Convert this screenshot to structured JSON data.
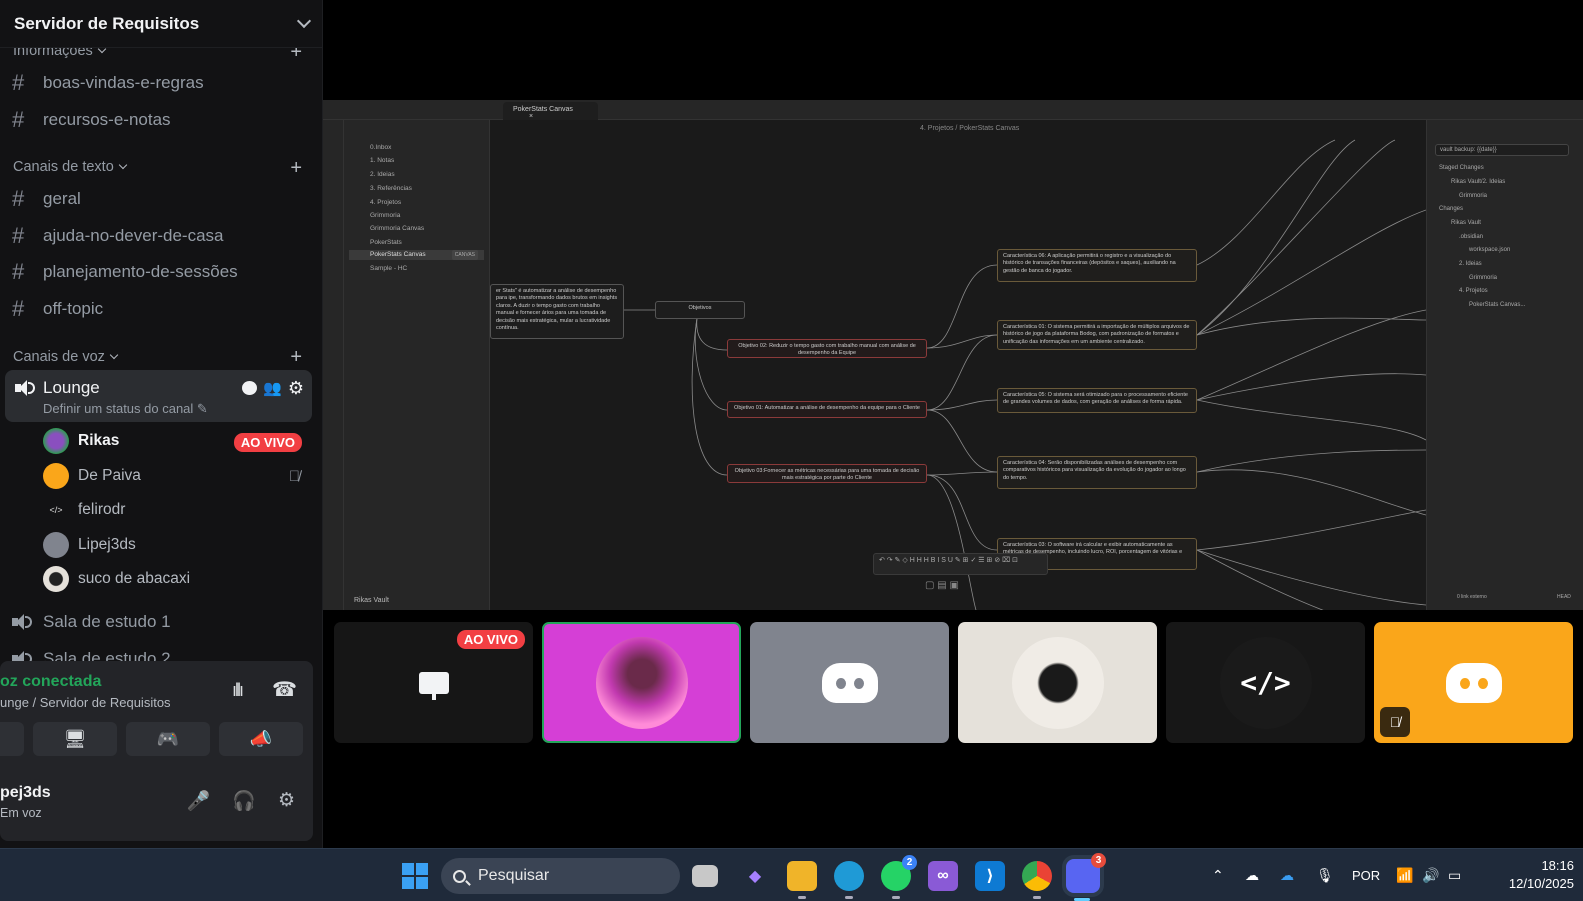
{
  "server": {
    "name": "Servidor de Requisitos"
  },
  "categories": {
    "info": "Informações",
    "text": "Canais de texto",
    "voice": "Canais de voz"
  },
  "info_channels": [
    "boas-vindas-e-regras",
    "recursos-e-notas"
  ],
  "text_channels": [
    "geral",
    "ajuda-no-dever-de-casa",
    "planejamento-de-sessões",
    "off-topic"
  ],
  "voice_channels": {
    "active": {
      "name": "Lounge",
      "status_placeholder": "Definir um status do canal"
    },
    "others": [
      "Sala de estudo 1",
      "Sala de estudo 2"
    ]
  },
  "voice_users": [
    {
      "name": "Rikas",
      "live": "AO VIVO"
    },
    {
      "name": "De Paiva"
    },
    {
      "name": "felirodr"
    },
    {
      "name": "Lipej3ds"
    },
    {
      "name": "suco de abacaxi"
    }
  ],
  "voice_panel": {
    "connected": "oz conectada",
    "location": "unge / Servidor de Requisitos",
    "username": "pej3ds",
    "user_status": "Em voz"
  },
  "stream": {
    "tab_title": "PokerStats Canvas",
    "breadcrumb": "4. Projetos / PokerStats Canvas",
    "vault_name": "Rikas Vault",
    "file_tree": [
      "0.Inbox",
      "1. Notas",
      "2. Ideias",
      "3. Referências",
      "4. Projetos",
      "Grimmoria",
      "Grimmoria Canvas",
      "PokerStats",
      "PokerStats Canvas",
      "Sample - HC"
    ],
    "file_tag": "CANVAS",
    "git_commit_placeholder": "vault backup: {{date}}",
    "git_tree": [
      "Staged Changes",
      "Rikas Vault/2. Ideias",
      "Grimmoria",
      "Changes",
      "Rikas Vault",
      ".obsidian",
      "workspace.json",
      "2. Ideias",
      "Grimmoria",
      "4. Projetos",
      "PokerStats Canvas..."
    ],
    "status_bar": "0 link externo",
    "status_bar_right": "HEAD",
    "nodes": {
      "intro": "er Stats\" é automatizar a análise de desempenho para ipe, transformando dados brutos em insights claros. A duzir o tempo gasto com trabalho manual e fornecer ários para uma tomada de decisão mais estratégica, mular a lucratividade contínua.",
      "objetivos": "Objetivos",
      "obj2": "Objetivo 02: Reduzir o tempo gasto com trabalho manual com análise de desempenho da Equipe",
      "obj1": "Objetivo 01: Automatizar a análise de desempenho da equipe para o Cliente",
      "obj3": "Objetivo 03:Fornecer as métricas necessárias para uma tomada de decisão mais estratégica por parte do Cliente",
      "c6": "Característica 06: A aplicação permitirá o registro e a visualização do histórico de transações financeiras (depósitos e saques), auxiliando na gestão de banca do jogador.",
      "c1": "Característica 01: O sistema permitirá a importação de múltiplos arquivos de histórico de jogo da plataforma Bodog, com padronização de formatos e unificação das informações em um ambiente centralizado.",
      "c5": "Característica 05: O sistema será otimizado para o processamento eficiente de grandes volumes de dados, com geração de análises de forma rápida.",
      "c4": "Característica 04: Serão disponibilizadas análises de desempenho com comparativos históricos para visualização da evolução do jogador ao longo do tempo.",
      "c3": "Característica 03: O software irá calcular e exibir automaticamente as métricas de desempenho, incluindo lucro, ROI, porcentagem de vitórias e ITM."
    }
  },
  "tiles": [
    {
      "type": "stream",
      "live": "AO VIVO"
    },
    {
      "type": "avatar"
    },
    {
      "type": "discord"
    },
    {
      "type": "avatar"
    },
    {
      "type": "code"
    },
    {
      "type": "discord-muted"
    }
  ],
  "taskbar": {
    "search": "Pesquisar",
    "whatsapp_badge": "2",
    "discord_badge": "3",
    "language": "POR",
    "time": "18:16",
    "date": "12/10/2025"
  },
  "colors": {
    "live_red": "#f23f43",
    "connected_green": "#23a55a",
    "discord_orange": "#faa61a",
    "discord_grey": "#80848e",
    "tile_magenta": "#d53fd6"
  }
}
